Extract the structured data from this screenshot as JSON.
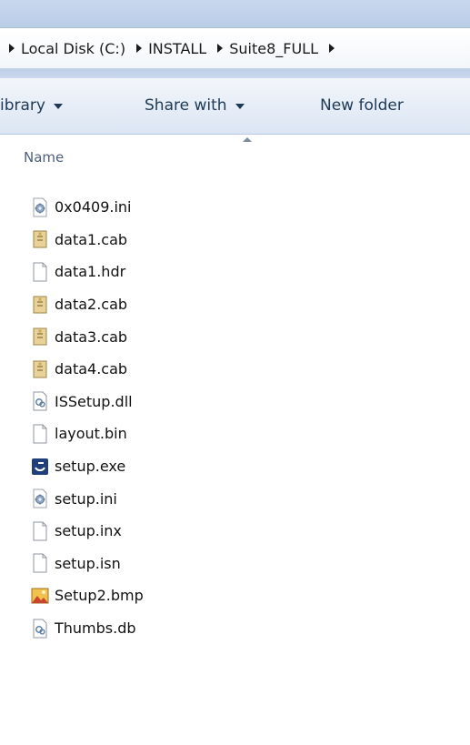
{
  "breadcrumb": {
    "items": [
      {
        "label": "Local Disk (C:)"
      },
      {
        "label": "INSTALL"
      },
      {
        "label": "Suite8_FULL"
      }
    ]
  },
  "toolbar": {
    "library_label": "ibrary",
    "share_label": "Share with",
    "new_folder_label": "New folder"
  },
  "columns": {
    "name_label": "Name"
  },
  "files": [
    {
      "name": "0x0409.ini",
      "icon": "settings-file-icon"
    },
    {
      "name": "data1.cab",
      "icon": "cabinet-file-icon"
    },
    {
      "name": "data1.hdr",
      "icon": "blank-file-icon"
    },
    {
      "name": "data2.cab",
      "icon": "cabinet-file-icon"
    },
    {
      "name": "data3.cab",
      "icon": "cabinet-file-icon"
    },
    {
      "name": "data4.cab",
      "icon": "cabinet-file-icon"
    },
    {
      "name": "ISSetup.dll",
      "icon": "dll-file-icon"
    },
    {
      "name": "layout.bin",
      "icon": "blank-file-icon"
    },
    {
      "name": "setup.exe",
      "icon": "installer-icon"
    },
    {
      "name": "setup.ini",
      "icon": "settings-file-icon"
    },
    {
      "name": "setup.inx",
      "icon": "blank-file-icon"
    },
    {
      "name": "setup.isn",
      "icon": "blank-file-icon"
    },
    {
      "name": "Setup2.bmp",
      "icon": "bitmap-image-icon"
    },
    {
      "name": "Thumbs.db",
      "icon": "dll-file-icon"
    }
  ],
  "colors": {
    "toolbar_text": "#1e3955",
    "header_text": "#4c607a",
    "accent": "#b9cde8"
  }
}
